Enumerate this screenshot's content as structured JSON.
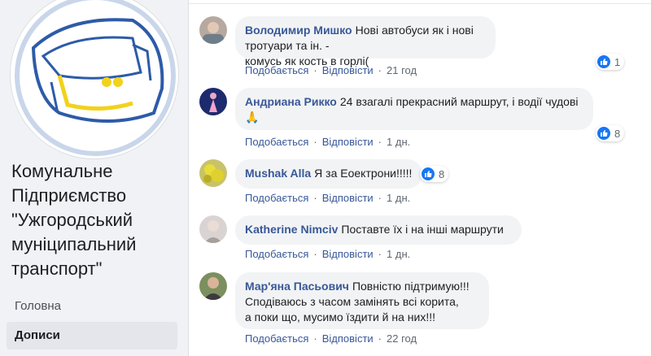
{
  "page": {
    "name_lines": [
      "Комунальне",
      "Підприємство",
      "\"Ужгородський",
      "муніципальний",
      "транспорт\""
    ],
    "nav": [
      {
        "label": "Головна",
        "active": false
      },
      {
        "label": "Дописи",
        "active": true
      }
    ]
  },
  "actions": {
    "like": "Подобається",
    "reply": "Відповісти"
  },
  "comments": [
    {
      "author": "Володимир Мишко",
      "text_lines": [
        "Нові автобуси як і нові тротуари та ін. -",
        "комусь як кость в горлі("
      ],
      "likes": "1",
      "time": "21 год"
    },
    {
      "author": "Андриана Рикко",
      "text_lines": [
        "24 взагалі прекрасний маршрут, і водії чудові",
        "🙏"
      ],
      "likes": "8",
      "time": "1 дн."
    },
    {
      "author": "Mushak Alla",
      "text_lines": [
        "Я за Еоектрони!!!!!"
      ],
      "likes": "8",
      "time": "1 дн."
    },
    {
      "author": "Katherine Nimciv",
      "text_lines": [
        "Поставте їх і на інші маршрути"
      ],
      "likes": "",
      "time": "1 дн."
    },
    {
      "author": "Мар'яна Пасьович",
      "text_lines": [
        "Повністю підтримую!!!",
        "Сподіваюсь з часом замінять всі корита,",
        "а поки що, мусимо їздити й на них!!!"
      ],
      "likes": "",
      "time": "22 год"
    }
  ],
  "colors": {
    "link": "#385898",
    "bubble": "#f2f3f5",
    "like_blue": "#1877f2",
    "logo_blue": "#2d5ba8",
    "logo_yellow": "#f2d21b"
  }
}
